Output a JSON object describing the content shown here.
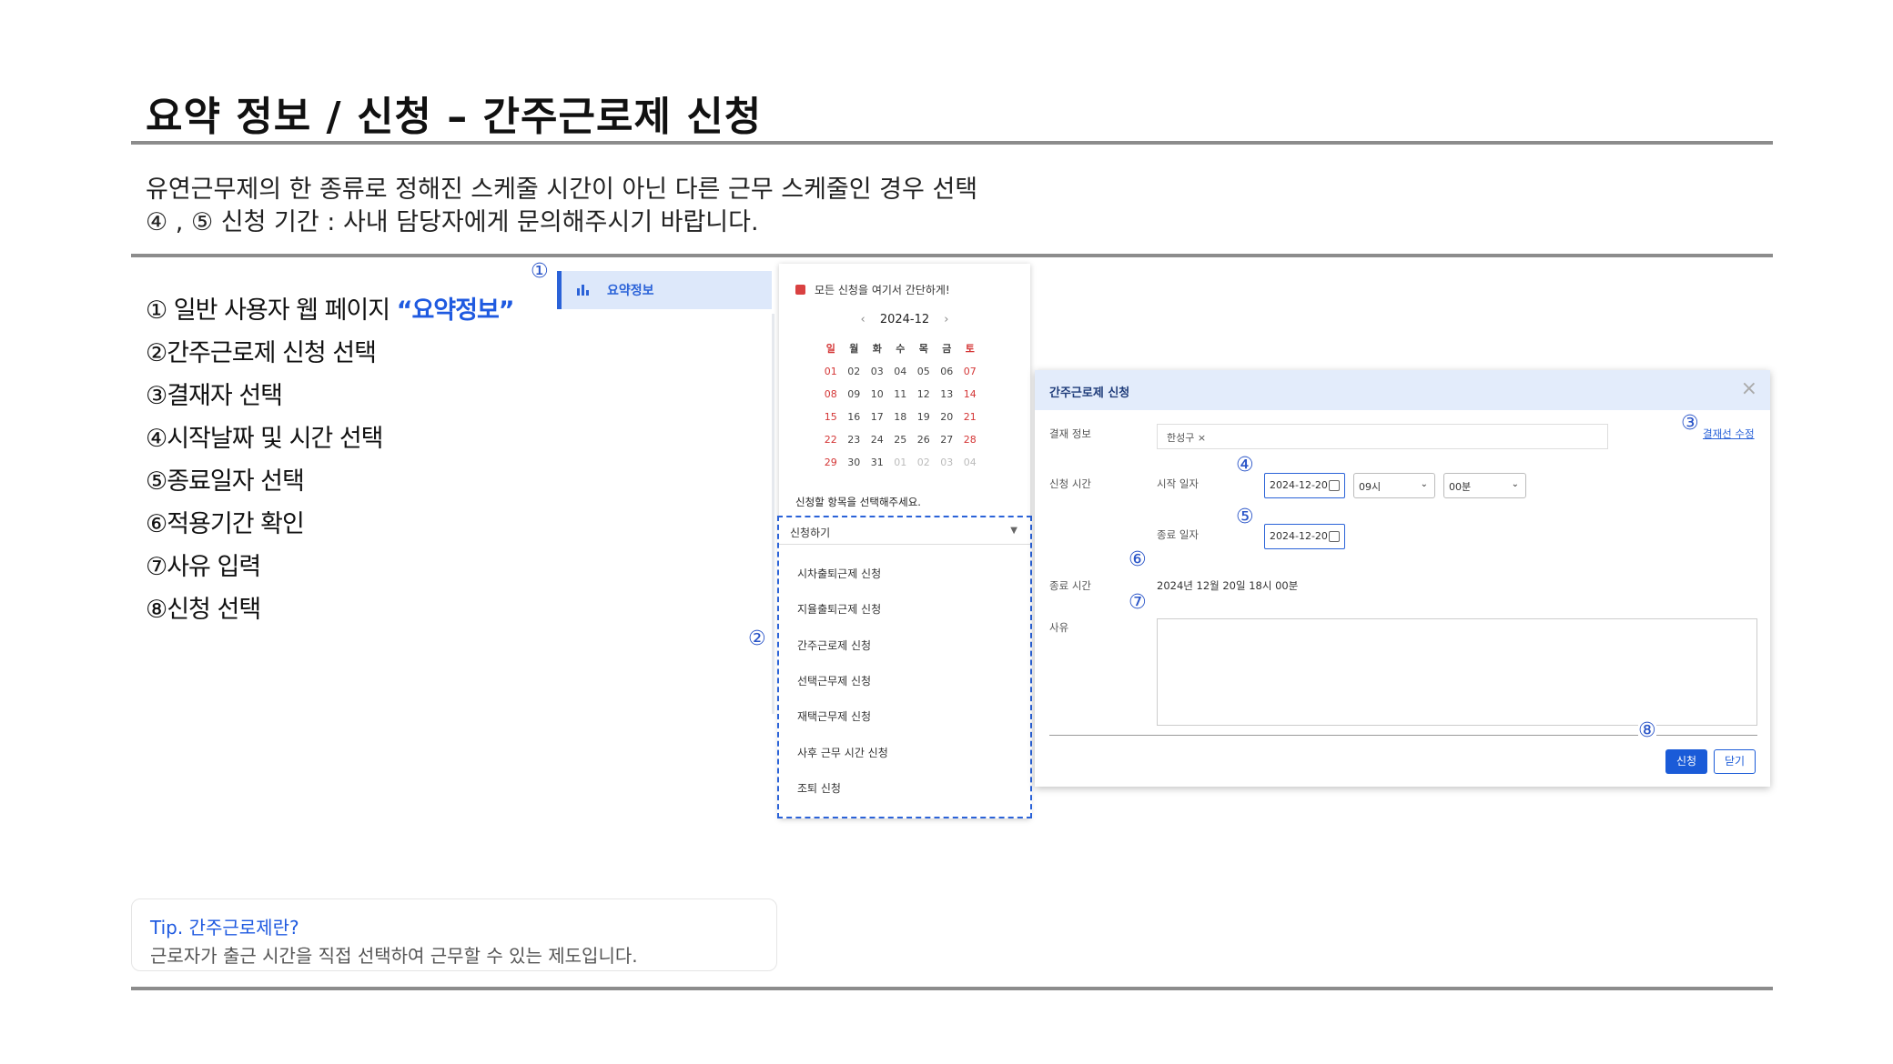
{
  "header": {
    "title": "요약 정보 / 신청 – 간주근로제 신청",
    "desc1": "유연근무제의 한 종류로 정해진 스케줄 시간이 아닌 다른 근무 스케줄인 경우 선택",
    "desc2": "④ , ⑤ 신청 기간 : 사내 담당자에게 문의해주시기 바랍니다."
  },
  "steps": [
    {
      "num": "①",
      "text": " 일반 사용자 웹 페이지 ",
      "highlight": "“요약정보”"
    },
    {
      "num": "②",
      "text": "간주근로제 신청 선택"
    },
    {
      "num": "③",
      "text": "결재자 선택"
    },
    {
      "num": "④",
      "text": "시작날짜 및 시간 선택"
    },
    {
      "num": "⑤",
      "text": "종료일자 선택"
    },
    {
      "num": "⑥",
      "text": "적용기간 확인"
    },
    {
      "num": "⑦",
      "text": "사유 입력"
    },
    {
      "num": "⑧",
      "text": "신청 선택"
    }
  ],
  "markers": {
    "m1": "①",
    "m2": "②",
    "m3": "③",
    "m4": "④",
    "m5": "⑤",
    "m6": "⑥",
    "m7": "⑦",
    "m8": "⑧"
  },
  "sidebar": {
    "item_label": "요약정보",
    "icon": "bar-chart-icon"
  },
  "calendar": {
    "heading": "모든 신청을 여기서 간단하게!",
    "month": "2024-12",
    "prev": "‹",
    "next": "›",
    "weekdays": [
      "일",
      "월",
      "화",
      "수",
      "목",
      "금",
      "토"
    ],
    "weeks": [
      [
        "01",
        "02",
        "03",
        "04",
        "05",
        "06",
        "07"
      ],
      [
        "08",
        "09",
        "10",
        "11",
        "12",
        "13",
        "14"
      ],
      [
        "15",
        "16",
        "17",
        "18",
        "19",
        "20",
        "21"
      ],
      [
        "22",
        "23",
        "24",
        "25",
        "26",
        "27",
        "28"
      ],
      [
        "29",
        "30",
        "31",
        "01",
        "02",
        "03",
        "04"
      ]
    ],
    "select_prompt": "신청할 항목을 선택해주세요.",
    "dropdown_label": "신청하기",
    "options": [
      "시차출퇴근제 신청",
      "지율출퇴근제 신청",
      "간주근로제 신청",
      "선택근무제 신청",
      "재택근무제 신청",
      "사후 근무 시간 신청",
      "조퇴 신청"
    ]
  },
  "modal": {
    "title": "간주근로제 신청",
    "close": "×",
    "approval_label": "결재 정보",
    "approver_tag": "한성구 ×",
    "approval_link": "결재선 수정",
    "apply_time_label": "신청 시간",
    "start_label": "시작 일자",
    "start_date": "2024-12-20",
    "hour": "09시",
    "minute": "00분",
    "end_label": "종료 일자",
    "end_date": "2024-12-20",
    "end_time_label": "종료 시간",
    "end_time_value": "2024년 12월 20일 18시 00분",
    "reason_label": "사유",
    "submit": "신청",
    "cancel": "닫기"
  },
  "tip": {
    "title": "Tip. 간주근로제란?",
    "body": "근로자가 출근 시간을 직접 선택하여 근무할 수 있는 제도입니다."
  },
  "colors": {
    "accent": "#1f5ae0",
    "sidebar_bg": "#dde8fa",
    "modal_head": "#e3ecfb",
    "red_day": "#d43535"
  }
}
